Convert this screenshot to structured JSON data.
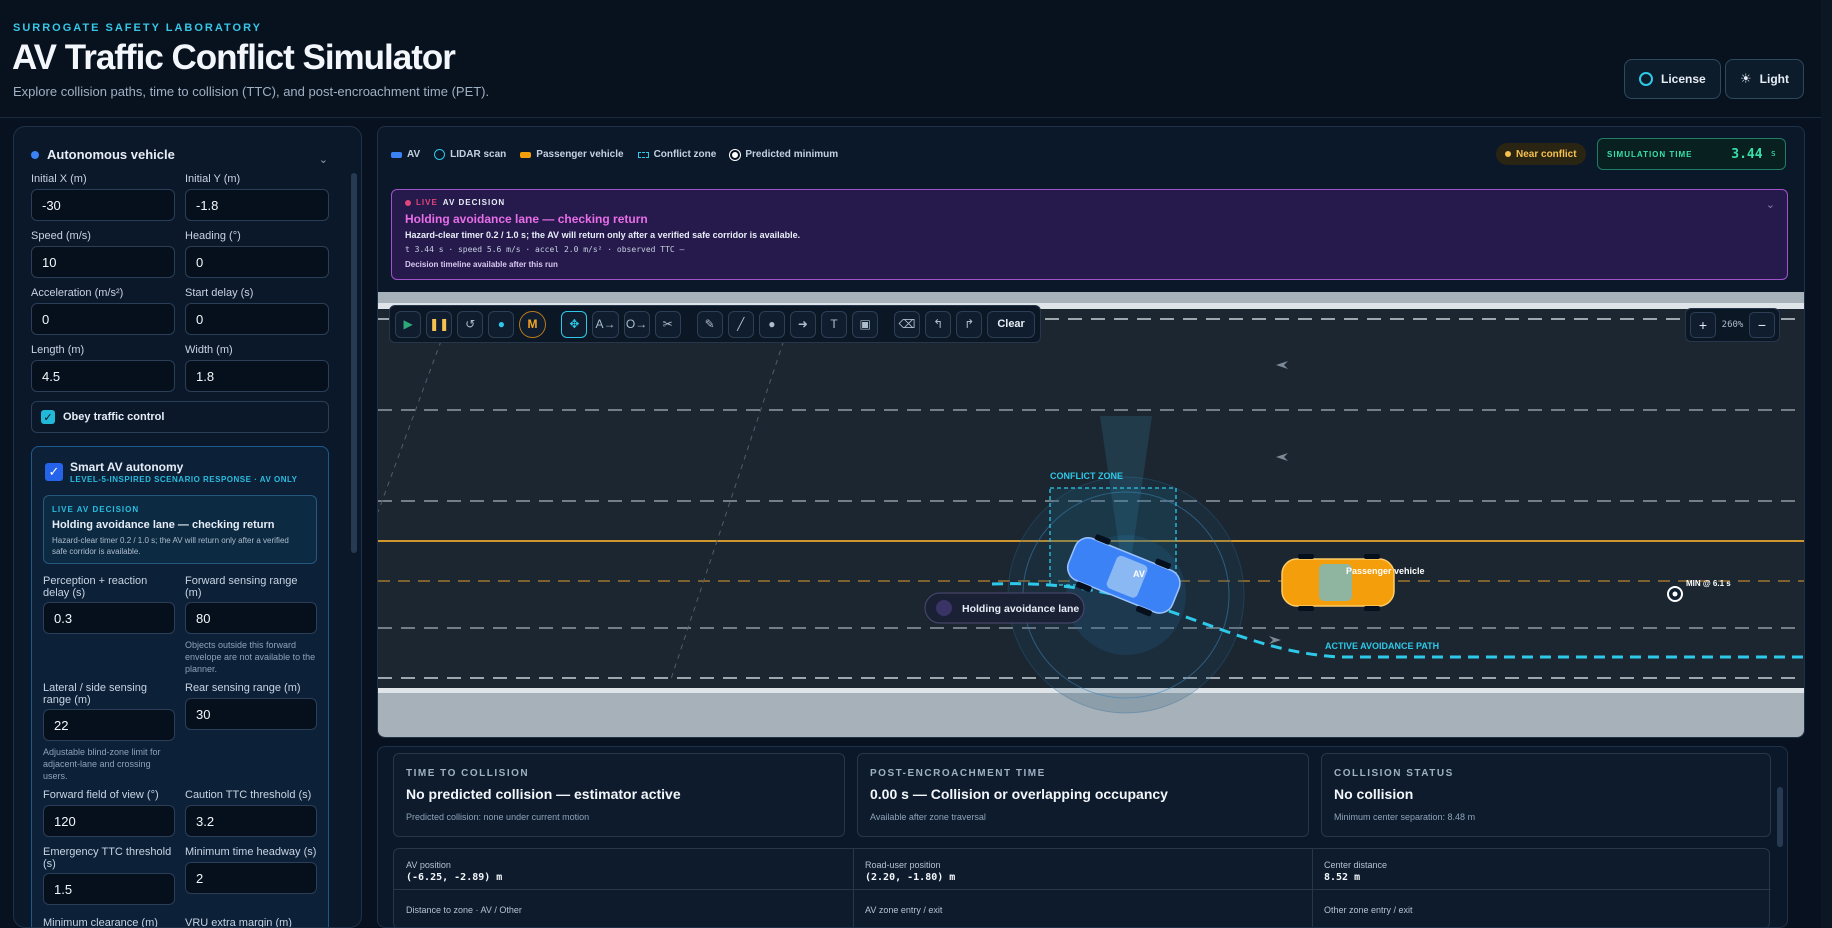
{
  "header": {
    "eyebrow": "SURROGATE SAFETY LABORATORY",
    "title": "AV Traffic Conflict Simulator",
    "subtitle": "Explore collision paths, time to collision (TTC), and post-encroachment time (PET).",
    "license_label": "License",
    "theme_label": "Light"
  },
  "sidebar": {
    "section_title": "Autonomous vehicle",
    "fields": [
      {
        "label": "Initial X (m)",
        "value": "-30"
      },
      {
        "label": "Initial Y (m)",
        "value": "-1.8"
      },
      {
        "label": "Speed (m/s)",
        "value": "10"
      },
      {
        "label": "Heading (°)",
        "value": "0"
      },
      {
        "label": "Acceleration (m/s²)",
        "value": "0"
      },
      {
        "label": "Start delay (s)",
        "value": "0"
      },
      {
        "label": "Length (m)",
        "value": "4.5"
      },
      {
        "label": "Width (m)",
        "value": "1.8"
      }
    ],
    "obey_label": "Obey traffic control",
    "smart": {
      "title": "Smart AV autonomy",
      "subtitle": "LEVEL-5-INSPIRED SCENARIO RESPONSE · AV ONLY",
      "live_eyebrow": "LIVE AV DECISION",
      "live_title": "Holding avoidance lane — checking return",
      "live_body": "Hazard-clear timer 0.2 / 1.0 s; the AV will return only after a verified safe corridor is available.",
      "perception_label": "Perception + reaction delay (s)",
      "perception_value": "0.3",
      "forward_range_label": "Forward sensing range (m)",
      "forward_range_value": "80",
      "forward_range_hint": "Objects outside this forward envelope are not available to the planner.",
      "lateral_label": "Lateral / side sensing range (m)",
      "lateral_value": "22",
      "lateral_hint": "Adjustable blind-zone limit for adjacent-lane and crossing users.",
      "rear_label": "Rear sensing range (m)",
      "rear_value": "30",
      "fov_label": "Forward field of view (°)",
      "fov_value": "120",
      "caution_label": "Caution TTC threshold (s)",
      "caution_value": "3.2",
      "emergency_label": "Emergency TTC threshold (s)",
      "emergency_value": "1.5",
      "headway_label": "Minimum time headway (s)",
      "headway_value": "2",
      "min_clearance_label": "Minimum clearance (m)",
      "vru_label": "VRU extra margin (m)"
    }
  },
  "legend": {
    "av": "AV",
    "lidar": "LIDAR scan",
    "passenger": "Passenger vehicle",
    "conflict": "Conflict zone",
    "predicted": "Predicted minimum"
  },
  "status": {
    "near_conflict": "Near conflict",
    "sim_time_label": "SIMULATION TIME",
    "sim_time_value": "3.44",
    "sim_time_unit": "s"
  },
  "decision": {
    "live": "LIVE",
    "eyebrow": "AV DECISION",
    "title": "Holding avoidance lane — checking return",
    "body": "Hazard-clear timer 0.2 / 1.0 s; the AV will return only after a verified safe corridor is available.",
    "telemetry": "t 3.44 s · speed 5.6 m/s · accel 2.0 m/s² · observed TTC —",
    "timeline_note": "Decision timeline available after this run"
  },
  "toolbar": {
    "clear_label": "Clear",
    "mode_label": "M",
    "zoom_value": "260%"
  },
  "scene": {
    "conflict_zone_label": "CONFLICT ZONE",
    "av_label": "AV",
    "passenger_label": "Passenger vehicle",
    "holding_label": "Holding avoidance lane",
    "path_label": "ACTIVE AVOIDANCE PATH",
    "min_label": "MIN @ 6.1 s"
  },
  "metrics": {
    "ttc": {
      "eyebrow": "TIME TO COLLISION",
      "value": "No predicted collision — estimator active",
      "note": "Predicted collision: none under current motion"
    },
    "pet": {
      "eyebrow": "POST-ENCROACHMENT TIME",
      "value": "0.00 s — Collision or overlapping occupancy",
      "note": "Available after zone traversal"
    },
    "collision": {
      "eyebrow": "COLLISION STATUS",
      "value": "No collision",
      "note": "Minimum center separation: 8.48 m"
    }
  },
  "details": {
    "av_position_label": "AV position",
    "av_position_value": "(-6.25, -2.89) m",
    "road_user_label": "Road-user position",
    "road_user_value": "(2.20, -1.80) m",
    "center_distance_label": "Center distance",
    "center_distance_value": "8.52 m",
    "zone_distance_label": "Distance to zone · AV / Other",
    "av_zone_label": "AV zone entry / exit",
    "other_zone_label": "Other zone entry / exit"
  },
  "colors": {
    "accent": "#2ec8e8",
    "av": "#3b82f6",
    "passenger": "#f59e0b",
    "decision_border": "#a052c9",
    "sim_time": "#38e0a8"
  }
}
